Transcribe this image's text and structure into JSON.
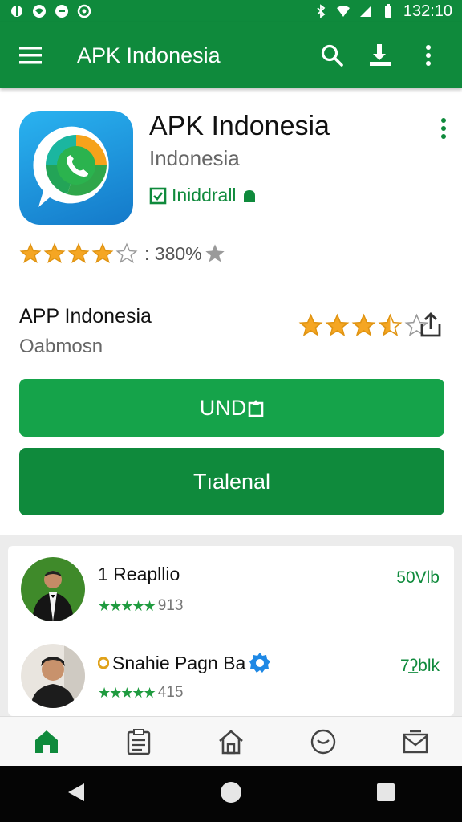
{
  "status_bar": {
    "time": "132:10"
  },
  "app_bar": {
    "title": "APK Indonesia"
  },
  "app": {
    "name": "APK Indonesia",
    "subtitle": "Indonesia",
    "installed_label": "Iniddrall",
    "rating_stars": 4,
    "rating_text": ": 380%"
  },
  "app2": {
    "name": "APP Indonesia",
    "subtitle": "Oabmosn",
    "rating_stars": 3.5
  },
  "buttons": {
    "primary_label": "UND",
    "secondary_label": "Tıalenal"
  },
  "list": [
    {
      "name": "1 Reapllio",
      "meta": "913",
      "size": "50Vlb"
    },
    {
      "name": "Snahie Pagn Ba",
      "meta": "415",
      "size": "7ʔ̲blk"
    }
  ],
  "colors": {
    "brand": "#0f8a3c",
    "primary_button": "#15a34a",
    "star": "#f5a623"
  }
}
